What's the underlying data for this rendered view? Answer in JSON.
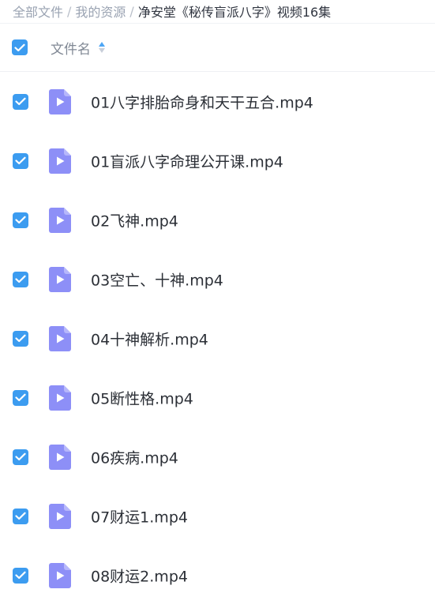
{
  "breadcrumb": {
    "root": "全部文件",
    "separator": "/",
    "parent": "我的资源",
    "current": "净安堂《秘传盲派八字》视频16集"
  },
  "header": {
    "column_label": "文件名",
    "select_all_checked": true
  },
  "colors": {
    "checkbox": "#3c9cf0",
    "file_icon": "#8d8ff7"
  },
  "files": [
    {
      "name": "01八字排胎命身和天干五合.mp4",
      "checked": true,
      "icon": "video-file-icon"
    },
    {
      "name": "01盲派八字命理公开课.mp4",
      "checked": true,
      "icon": "video-file-icon"
    },
    {
      "name": "02飞神.mp4",
      "checked": true,
      "icon": "video-file-icon"
    },
    {
      "name": "03空亡、十神.mp4",
      "checked": true,
      "icon": "video-file-icon"
    },
    {
      "name": "04十神解析.mp4",
      "checked": true,
      "icon": "video-file-icon"
    },
    {
      "name": "05断性格.mp4",
      "checked": true,
      "icon": "video-file-icon"
    },
    {
      "name": "06疾病.mp4",
      "checked": true,
      "icon": "video-file-icon"
    },
    {
      "name": "07财运1.mp4",
      "checked": true,
      "icon": "video-file-icon"
    },
    {
      "name": "08财运2.mp4",
      "checked": true,
      "icon": "video-file-icon"
    }
  ]
}
